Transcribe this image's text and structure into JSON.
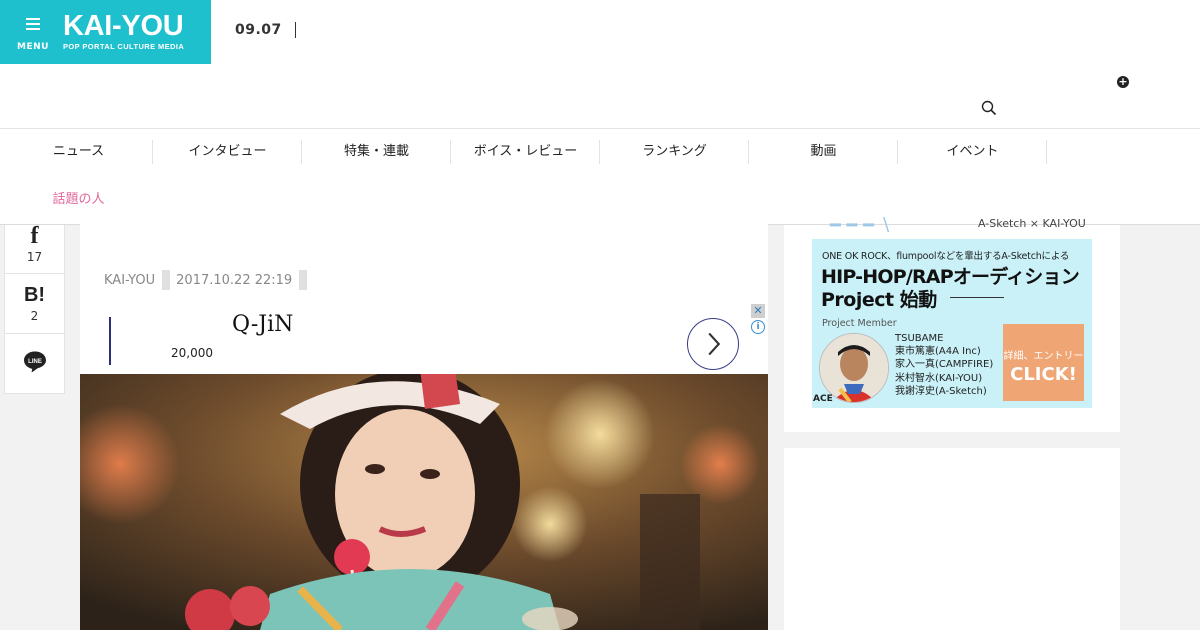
{
  "brand": {
    "menu_label": "MENU",
    "logo_title": "KAI-YOU",
    "logo_subtitle": "POP PORTAL CULTURE MEDIA",
    "accent_color": "#1ec0cd"
  },
  "header": {
    "date": "09.07",
    "icons": [
      "menu-icon",
      "plus-circle-icon",
      "search-icon"
    ]
  },
  "nav": {
    "items": [
      {
        "label": "ニュース"
      },
      {
        "label": "インタビュー"
      },
      {
        "label": "特集・連載"
      },
      {
        "label": "ボイス・レビュー"
      },
      {
        "label": "ランキング"
      },
      {
        "label": "動画"
      },
      {
        "label": "イベント"
      },
      {
        "label": "話題の人"
      }
    ],
    "highlight_color": "#e2689a"
  },
  "share": {
    "facebook": {
      "icon": "facebook-icon",
      "count": "17"
    },
    "hatena": {
      "icon": "hatena-bookmark-icon",
      "label": "B!",
      "count": "2"
    },
    "line": {
      "icon": "line-icon",
      "label": "LINE"
    }
  },
  "article": {
    "author": "KAI-YOU",
    "published": "2017.10.22 22:19"
  },
  "ad": {
    "name": "Q-JiN",
    "price": "20,000",
    "close_icon": "close-icon",
    "info_icon": "info-icon"
  },
  "sidebar": {
    "banner": {
      "top_right": "A-Sketch × KAI-YOU",
      "lead": "ONE OK ROCK、flumpoolなどを輩出するA-Sketchによる",
      "title_line1": "HIP-HOP/RAPオーディション",
      "title_line2": "Project 始動",
      "project_member_label": "Project Member",
      "members": [
        "TSUBAME",
        "東市篤憲(A4A Inc)",
        "家入一真(CAMPFIRE)",
        "米村智水(KAI-YOU)",
        "我謝淳史(A-Sketch)"
      ],
      "cta_top": "詳細、エントリー",
      "cta_main": "CLICK!",
      "avatar_caption": "ACE"
    }
  }
}
